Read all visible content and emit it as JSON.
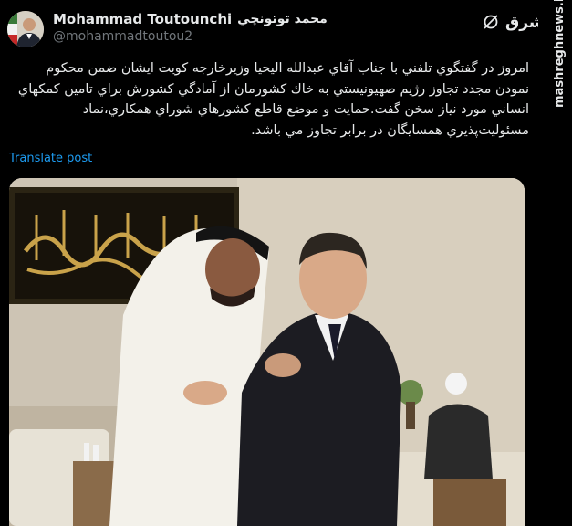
{
  "author": {
    "display_name": "Mohammad Toutounchi",
    "display_name_fa": "محمد توتونچي",
    "handle": "@mohammadtoutou2"
  },
  "tweet": {
    "text": "امروز در گفتگوي تلفني با جناب آقاي عبدالله اليحيا وزيرخارجه كويت ايشان ضمن محكوم نمودن مجدد تجاوز رژيم صهيونيستي به خاك كشورمان از آمادگي كشورش براي تامين كمكهاي انساني مورد نياز سخن گفت.حمايت و موضع قاطع كشورهاي شوراي همكاري،نماد مسئوليت‌پذيري همسايگان در برابر تجاوز مي باشد.",
    "translate_label": "Translate post"
  },
  "watermark": {
    "logo_text": "مشرق",
    "site": "mashreghnews.ir"
  },
  "icons": {
    "grok": "grok-icon",
    "avatar": "avatar-photo"
  },
  "colors": {
    "background": "#000000",
    "text": "#e7e9ea",
    "secondary": "#71767b",
    "link": "#1d9bf0"
  }
}
